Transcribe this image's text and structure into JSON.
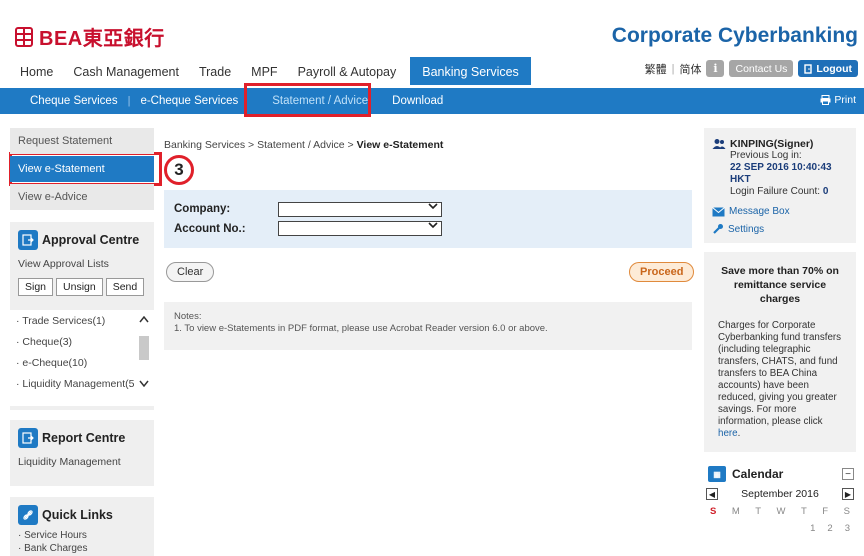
{
  "brand": {
    "logo_text": "BEA東亞銀行",
    "title": "Corporate Cyberbanking",
    "logo_color": "#c8102e",
    "title_color": "#1b64a8"
  },
  "main_nav": {
    "items": [
      {
        "label": "Home"
      },
      {
        "label": "Cash Management"
      },
      {
        "label": "Trade"
      },
      {
        "label": "MPF"
      },
      {
        "label": "Payroll & Autopay"
      },
      {
        "label": "Banking Services",
        "active": true
      }
    ]
  },
  "utility": {
    "lang_trad": "繁體",
    "lang_sep": "|",
    "lang_simp": "简体",
    "info": "i",
    "contact": "Contact Us",
    "logout": "Logout"
  },
  "sub_nav": {
    "items": [
      {
        "label": "Cheque Services"
      },
      {
        "label": "e-Cheque Services"
      },
      {
        "label": "Statement / Advice",
        "active": true
      },
      {
        "label": "Download"
      }
    ],
    "separator": "|",
    "print": "Print",
    "accent": "#1f7ac4"
  },
  "annotation": {
    "step_number": "3",
    "highlight_color": "#e0202a"
  },
  "sidebar": {
    "menu": [
      {
        "label": "Request Statement"
      },
      {
        "label": "View e-Statement",
        "active": true
      },
      {
        "label": "View e-Advice"
      }
    ],
    "approval": {
      "title": "Approval Centre",
      "subtitle": "View Approval Lists",
      "tabs": [
        "Sign",
        "Unsign",
        "Send"
      ],
      "items": [
        "· Trade Services(1)",
        "· Cheque(3)",
        "· e-Cheque(10)",
        "· Liquidity Management(5"
      ]
    },
    "report": {
      "title": "Report Centre",
      "subtitle": "Liquidity Management"
    },
    "quick_links": {
      "title": "Quick Links",
      "items": [
        "· Service Hours",
        "· Bank Charges"
      ]
    }
  },
  "main": {
    "breadcrumb_path": "Banking Services > Statement / Advice > ",
    "breadcrumb_current": "View e-Statement",
    "form": {
      "company_label": "Company:",
      "company_value": "",
      "account_label": "Account No.:",
      "account_value": ""
    },
    "clear_label": "Clear",
    "proceed_label": "Proceed",
    "notes_title": "Notes:",
    "notes_line": "1. To view  e-Statements in PDF format, please use Acrobat Reader version 6.0 or above."
  },
  "user": {
    "name": "KINPING(Signer)",
    "prev_label": "Previous Log in:",
    "prev_value": "22 SEP 2016 10:40:43 HKT",
    "failure_label": "Login Failure Count: ",
    "failure_value": "0",
    "message_box": "Message Box",
    "settings": "Settings"
  },
  "promo": {
    "title": "Save more than 70% on remittance service charges",
    "text": "Charges for Corporate Cyberbanking fund transfers (including telegraphic transfers, CHATS, and fund transfers to BEA China accounts) have been reduced, giving you greater savings. For more information, please click ",
    "link": "here",
    "end": "."
  },
  "calendar": {
    "title": "Calendar",
    "month": "September 2016",
    "prev": "◀",
    "next": "▶",
    "minimize": "−",
    "days": [
      "S",
      "M",
      "T",
      "W",
      "T",
      "F",
      "S"
    ],
    "first_dates": [
      "1",
      "2",
      "3"
    ]
  }
}
